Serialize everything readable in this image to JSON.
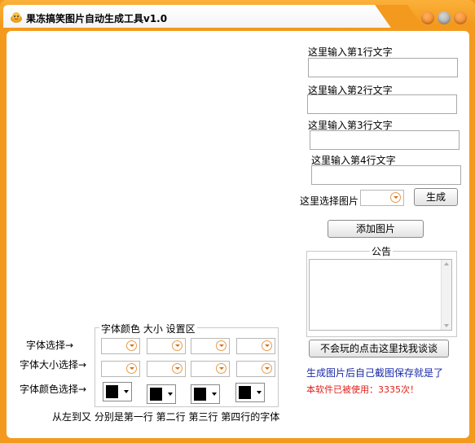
{
  "window": {
    "title": "果冻搞笑图片自动生成工具v1.0",
    "accent_color": "#f39a1e"
  },
  "inputs": {
    "line1_label": "这里输入第1行文字",
    "line1_value": "",
    "line2_label": "这里输入第2行文字",
    "line2_value": "",
    "line3_label": "这里输入第3行文字",
    "line3_value": "",
    "line4_label": "这里输入第4行文字",
    "line4_value": ""
  },
  "image_select": {
    "label": "这里选择图片",
    "value": ""
  },
  "buttons": {
    "generate": "生成",
    "add_image": "添加图片",
    "help": "不会玩的点击这里找我谈谈"
  },
  "notice": {
    "title": "公告",
    "content": ""
  },
  "info": {
    "save_hint": "生成图片后自己截图保存就是了",
    "usage_count": "本软件已被使用：3335次！",
    "save_hint_color": "#1a2aa8",
    "usage_color": "#e0201a"
  },
  "settings": {
    "group_title": "字体颜色 大小 设置区",
    "font_select_label": "字体选择→",
    "font_size_label": "字体大小选择→",
    "font_color_label": "字体颜色选择→",
    "footer_note": "从左到又 分别是第一行 第二行 第三行 第四行的字体",
    "font_color_value": "#000000"
  }
}
